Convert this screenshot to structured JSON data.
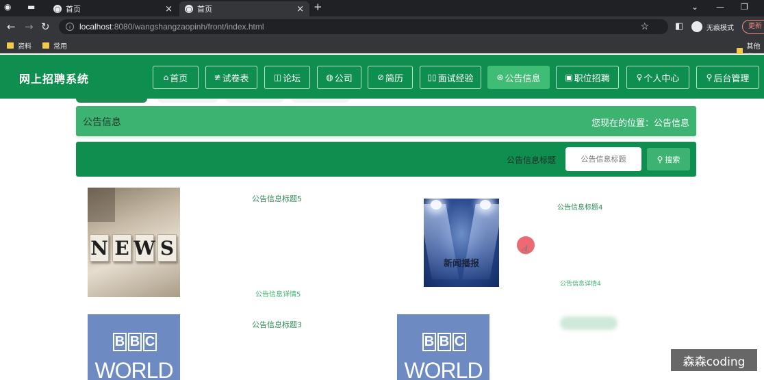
{
  "browser": {
    "tabs": [
      {
        "label": "首页",
        "close": "×"
      },
      {
        "label": "首页",
        "close": "×"
      }
    ],
    "new_tab": "+",
    "window_controls": [
      "⌄",
      "—",
      "❐"
    ],
    "address": {
      "host": "localhost",
      "path": ":8080/wangshangzaopinh/front/index.html"
    },
    "incognito_label": "无痕模式",
    "update_label": "更新",
    "bookmarks": [
      "资料",
      "常用"
    ],
    "bookmarks_other": "其他书"
  },
  "site": {
    "title": "网上招聘系统",
    "nav": [
      {
        "icon": "⌂",
        "label": "首页"
      },
      {
        "icon": "≢",
        "label": "试卷表"
      },
      {
        "icon": "◫",
        "label": "论坛"
      },
      {
        "icon": "◍",
        "label": "公司"
      },
      {
        "icon": "⊘",
        "label": "简历"
      },
      {
        "icon": "▯▯",
        "label": "面试经验"
      },
      {
        "icon": "⊛",
        "label": "公告信息"
      },
      {
        "icon": "▣",
        "label": "职位招聘"
      },
      {
        "icon": "♀",
        "label": "个人中心"
      },
      {
        "icon": "⚲",
        "label": "后台管理"
      }
    ],
    "active_nav_index": 6
  },
  "page": {
    "section_title": "公告信息",
    "location": "您现在的位置：公告信息"
  },
  "search": {
    "label": "公告信息标题",
    "placeholder": "公告信息标题",
    "button": "搜索",
    "button_icon": "⚲"
  },
  "news": [
    {
      "title": "公告信息标题5",
      "detail": "公告信息详情5",
      "image_text": "NEWS"
    },
    {
      "title": "公告信息标题4",
      "detail": "公告信息详情4",
      "image_text": "新闻播报"
    },
    {
      "title": "公告信息标题3",
      "image_text_top": "BBC",
      "image_text_bottom": "WORLD"
    },
    {
      "image_text_top": "BBC",
      "image_text_bottom": "WORLD"
    }
  ],
  "watermark": "森森coding",
  "colors": {
    "header": "#0f8f4f",
    "accent": "#3cb371",
    "active_nav": "#3fbd75"
  }
}
